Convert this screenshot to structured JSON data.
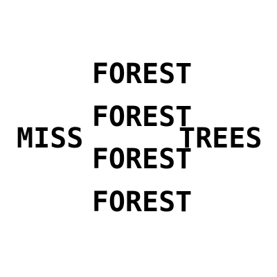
{
  "puzzle": {
    "stack": [
      "FOREST",
      "FOREST",
      "FOREST",
      "FOREST"
    ],
    "left": "MISS",
    "right": "TREES"
  },
  "colors": {
    "background": "#ffffff",
    "text": "#000000"
  }
}
